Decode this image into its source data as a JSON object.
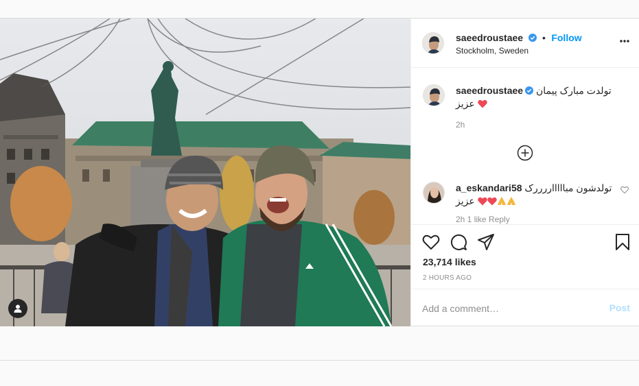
{
  "post": {
    "username": "saeedroustaee",
    "location": "Stockholm, Sweden",
    "follow_label": "Follow",
    "dot": "•",
    "likes": "23,714 likes",
    "timestamp": "2 HOURS AGO"
  },
  "caption": {
    "username": "saeedroustaee",
    "text": "تولدت مبارک پیمان عزیز",
    "time": "2h"
  },
  "comment": {
    "username": "a_eskandari58",
    "text": "تولدشون مباااااررررک عزیز",
    "meta": "2h   1 like   Reply"
  },
  "add_comment": {
    "placeholder": "Add a comment…",
    "post_label": "Post"
  },
  "colors": {
    "accent": "#0095f6",
    "post_disabled": "#b2dffc",
    "heart": "#ed4956"
  },
  "icons": {
    "verified": "verified-badge-icon",
    "more": "more-options-icon",
    "like": "heart-icon",
    "comment": "comment-icon",
    "share": "share-icon",
    "save": "bookmark-icon",
    "tag": "user-tag-icon",
    "load_more": "plus-circle-icon"
  }
}
